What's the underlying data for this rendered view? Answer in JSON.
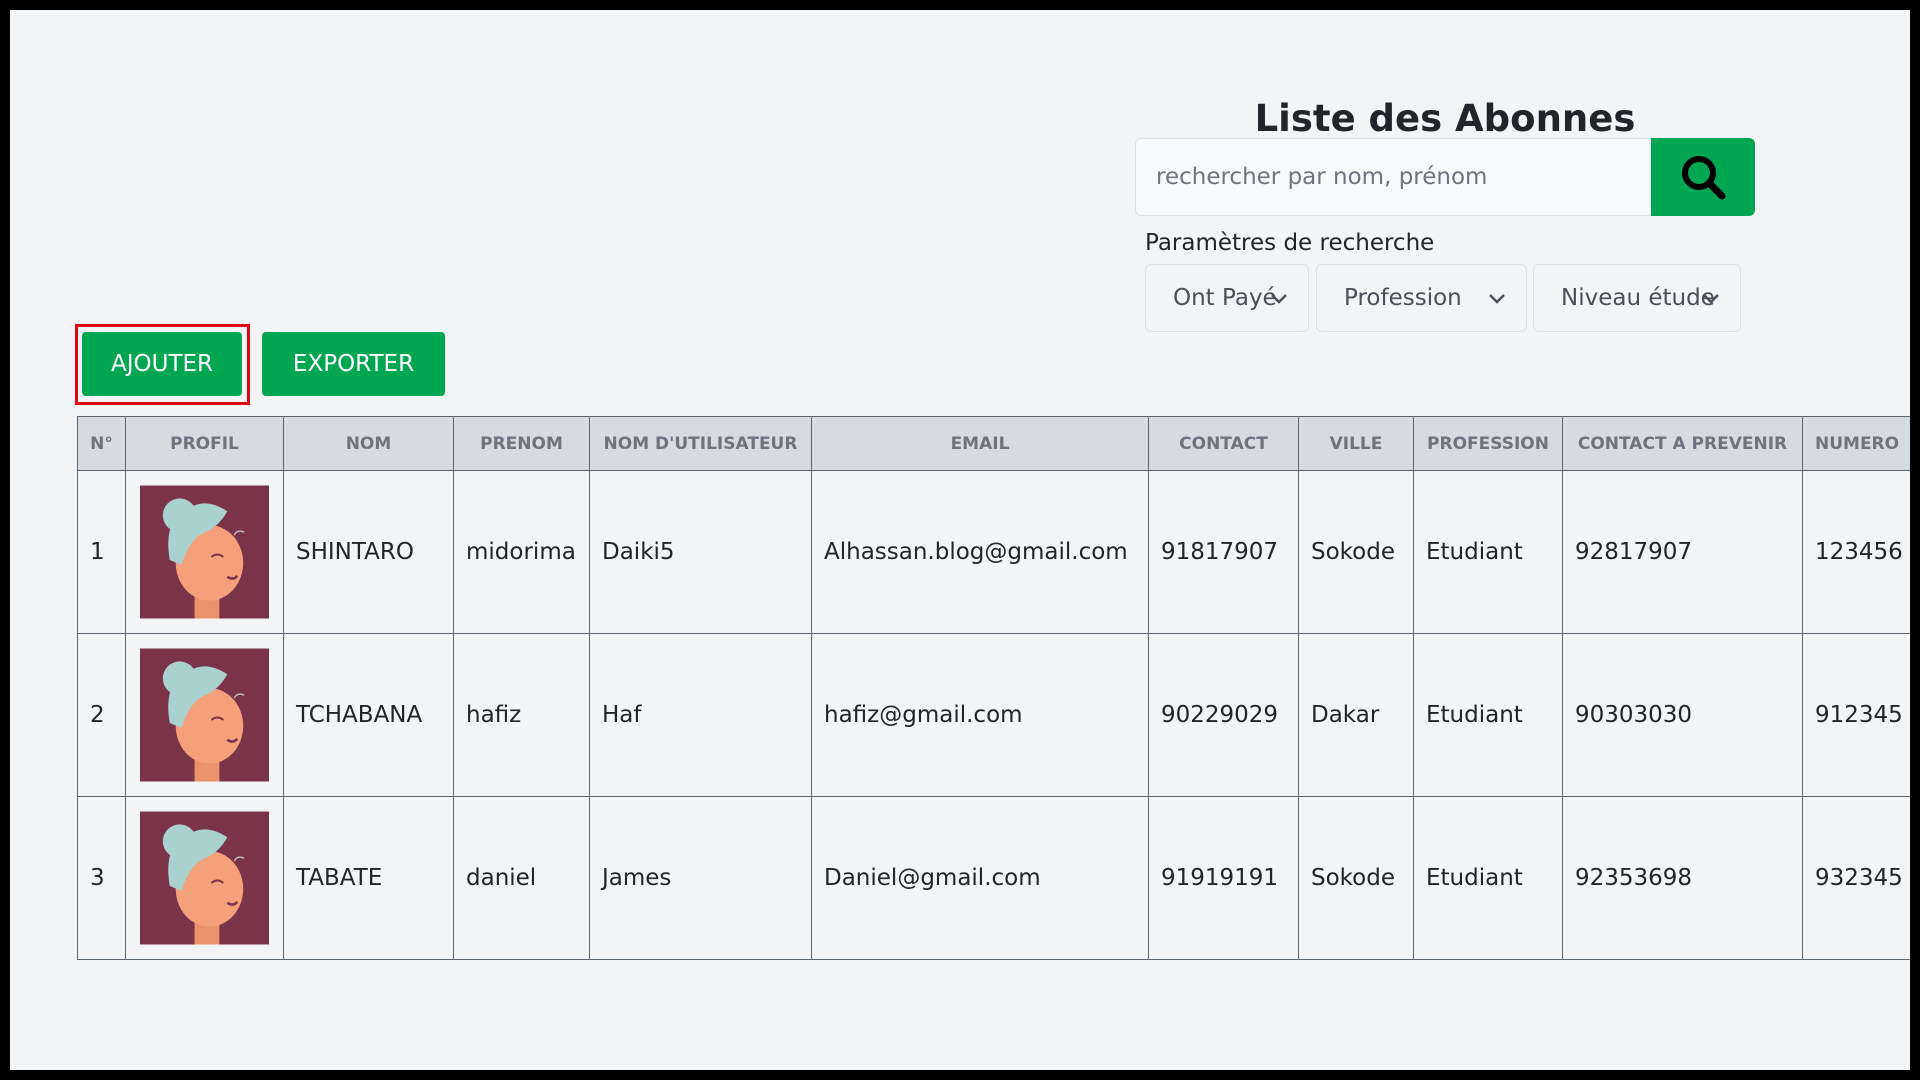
{
  "header": {
    "title": "Liste des Abonnes"
  },
  "search": {
    "placeholder": "rechercher par nom, prénom",
    "value": "",
    "params_label": "Paramètres de recherche",
    "filters": [
      {
        "label": "Ont Payé"
      },
      {
        "label": "Profession"
      },
      {
        "label": "Niveau étude"
      }
    ]
  },
  "actions": {
    "add_label": "AJOUTER",
    "export_label": "EXPORTER"
  },
  "table": {
    "columns": [
      "N°",
      "PROFIL",
      "NOM",
      "PRENOM",
      "NOM D'UTILISATEUR",
      "EMAIL",
      "CONTACT",
      "VILLE",
      "PROFESSION",
      "CONTACT A PREVENIR",
      "NUMERO"
    ],
    "rows": [
      {
        "n": "1",
        "nom": "SHINTARO",
        "prenom": "midorima",
        "username": "Daiki5",
        "email": "Alhassan.blog@gmail.com",
        "contact": "91817907",
        "ville": "Sokode",
        "profession": "Etudiant",
        "contact_prevenir": "92817907",
        "numero": "123456"
      },
      {
        "n": "2",
        "nom": "TCHABANA",
        "prenom": "hafiz",
        "username": "Haf",
        "email": "hafiz@gmail.com",
        "contact": "90229029",
        "ville": "Dakar",
        "profession": "Etudiant",
        "contact_prevenir": "90303030",
        "numero": "912345"
      },
      {
        "n": "3",
        "nom": "TABATE",
        "prenom": "daniel",
        "username": "James",
        "email": "Daniel@gmail.com",
        "contact": "91919191",
        "ville": "Sokode",
        "profession": "Etudiant",
        "contact_prevenir": "92353698",
        "numero": "932345"
      }
    ]
  },
  "icons": {
    "search": "search-icon",
    "chevron": "chevron-down-icon",
    "avatar": "avatar-icon"
  },
  "colors": {
    "primary": "#00a651",
    "highlight": "#e30613",
    "header_bg": "#d6dbe0",
    "avatar_bg": "#7b3349"
  }
}
